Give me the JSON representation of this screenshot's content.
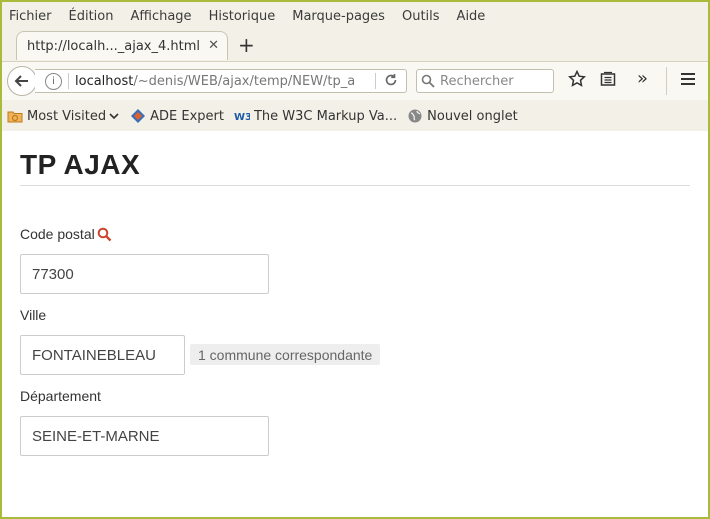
{
  "menu": [
    "Fichier",
    "Édition",
    "Affichage",
    "Historique",
    "Marque-pages",
    "Outils",
    "Aide"
  ],
  "tab": {
    "title": "http://localh..._ajax_4.html",
    "close": "✕",
    "new_tab": "+"
  },
  "nav": {
    "url_host": "localhost",
    "url_path": "/~denis/WEB/ajax/temp/NEW/tp_a",
    "search_placeholder": "Rechercher"
  },
  "bookmarks": [
    {
      "label": "Most Visited",
      "icon": "folder-icon"
    },
    {
      "label": "ADE Expert",
      "icon": "ade-icon"
    },
    {
      "label": "The W3C Markup Va...",
      "icon": "w3c-icon"
    },
    {
      "label": "Nouvel onglet",
      "icon": "globe-icon"
    }
  ],
  "page": {
    "title": "TP AJAX",
    "postal_label": "Code postal",
    "postal_value": "77300",
    "ville_label": "Ville",
    "ville_value": "FONTAINEBLEAU",
    "ville_hint": "1 commune correspondante",
    "dept_label": "Département",
    "dept_value": "SEINE-ET-MARNE"
  },
  "colors": {
    "frame": "#a8bb3a",
    "search_icon": "#c9452e"
  }
}
